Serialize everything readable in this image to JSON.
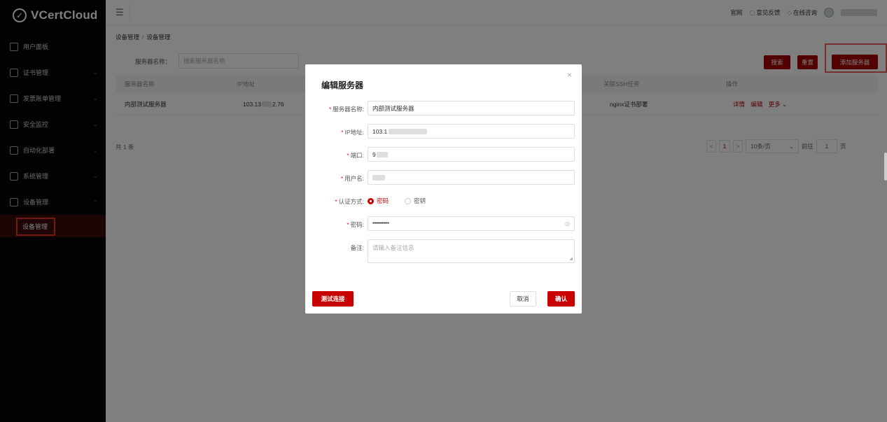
{
  "app": {
    "name": "VCertCloud"
  },
  "sidebar": {
    "items": [
      {
        "label": "用户面板",
        "caret": ""
      },
      {
        "label": "证书管理",
        "caret": "⌄"
      },
      {
        "label": "发票账单管理",
        "caret": "⌄"
      },
      {
        "label": "安全监控",
        "caret": "⌄"
      },
      {
        "label": "自动化部署",
        "caret": "⌄"
      },
      {
        "label": "系统管理",
        "caret": "⌄"
      },
      {
        "label": "设备管理",
        "caret": "⌃"
      }
    ],
    "active_sub": "设备管理"
  },
  "topbar": {
    "menu_icon": "☰",
    "official_site": "官网",
    "feedback": "意见反馈",
    "consult": "在线咨询"
  },
  "breadcrumb": {
    "first": "设备管理",
    "separator": "/",
    "second": "设备管理"
  },
  "search": {
    "label": "服务器名称：",
    "placeholder": "搜索服务器名称"
  },
  "buttons": {
    "search": "搜索",
    "reset": "重置",
    "add": "添加服务器"
  },
  "table": {
    "headers": [
      "服务器名称",
      "IP地址",
      "关联SSH任务",
      "操作"
    ],
    "rows": [
      {
        "name": "内部测试服务器",
        "ip_prefix": "103.13",
        "ip_suffix": "2.76",
        "ssh_task": "nginx证书部署",
        "op_detail": "详情",
        "op_edit": "编辑",
        "op_more": "更多 ⌄"
      }
    ]
  },
  "pagination": {
    "total": "共 1 条",
    "prev": "<",
    "current_page": "1",
    "next": ">",
    "page_size": "10条/页",
    "goto_label": "前往",
    "goto_value": "1",
    "page_unit": "页"
  },
  "modal": {
    "title": "编辑服务器",
    "close": "×",
    "fields": {
      "name": {
        "label": "服务器名称:",
        "value": "内部测试服务器"
      },
      "ip": {
        "label": "IP地址:",
        "value": "103.1"
      },
      "port": {
        "label": "端口:",
        "value": "9"
      },
      "username": {
        "label": "用户名:",
        "value": ""
      },
      "auth": {
        "label": "认证方式:",
        "option_password": "密码",
        "option_key": "密钥",
        "selected": "密码"
      },
      "password": {
        "label": "密码:",
        "value": "••••••••••••"
      },
      "remark": {
        "label": "备注:",
        "placeholder": "请输入备注信息"
      }
    },
    "buttons": {
      "test": "测试连接",
      "cancel": "取消",
      "confirm": "确认"
    }
  },
  "colors": {
    "primary": "#a50000",
    "danger": "#e02020",
    "sidebar_bg": "#050505"
  }
}
